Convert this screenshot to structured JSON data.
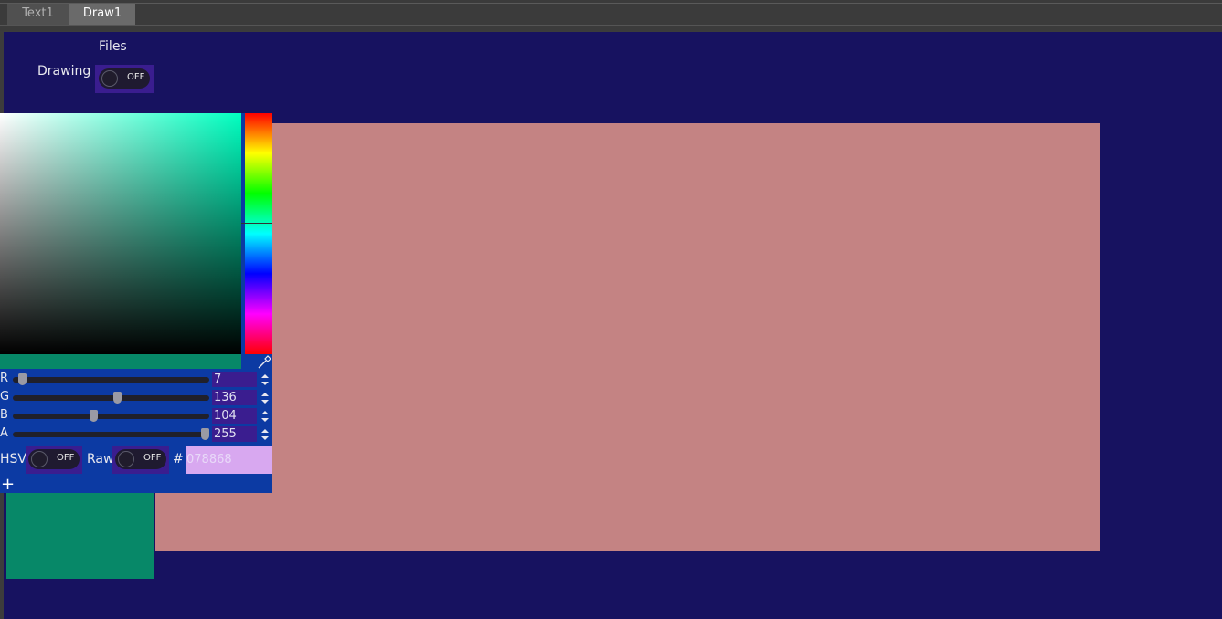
{
  "tabs": [
    {
      "label": "Text1",
      "active": false
    },
    {
      "label": "Draw1",
      "active": true
    }
  ],
  "top": {
    "files_label": "Files",
    "drawing_label": "Drawing",
    "drawing_toggle": "OFF"
  },
  "picker": {
    "channels": [
      {
        "name": "R",
        "value": "7",
        "fraction": 0.027
      },
      {
        "name": "G",
        "value": "136",
        "fraction": 0.533
      },
      {
        "name": "B",
        "value": "104",
        "fraction": 0.408
      },
      {
        "name": "A",
        "value": "255",
        "fraction": 1.0
      }
    ],
    "hsv_label": "HSV",
    "hsv_toggle": "OFF",
    "raw_label": "Raw",
    "raw_toggle": "OFF",
    "hash": "#",
    "hex_value": "078868",
    "current_color": "#078868"
  },
  "canvas": {
    "color": "#c48383"
  },
  "colors": {
    "panel": "#171260",
    "accent": "#3a1d8f",
    "picker_bg": "#0c3aa3"
  }
}
